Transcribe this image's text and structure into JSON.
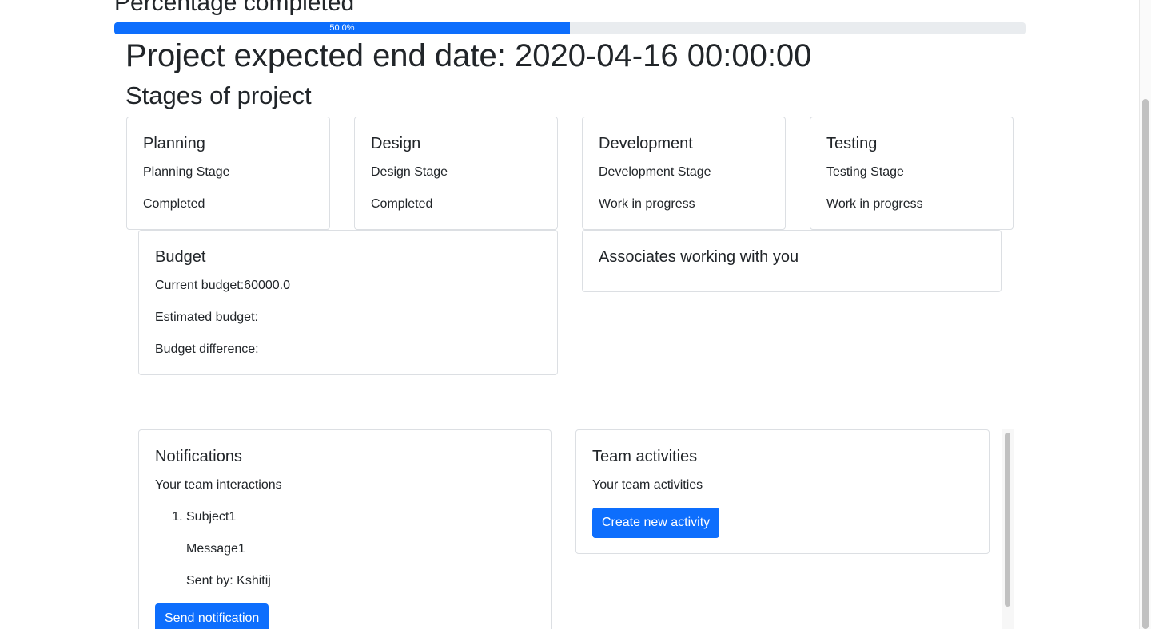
{
  "progress": {
    "title": "Percentage completed",
    "value_percent": 50.0,
    "label": "50.0%"
  },
  "project": {
    "end_date_heading": "Project expected end date: 2020-04-16 00:00:00",
    "stages_heading": "Stages of project"
  },
  "stages": [
    {
      "title": "Planning",
      "description": "Planning Stage",
      "status": "Completed"
    },
    {
      "title": "Design",
      "description": "Design Stage",
      "status": "Completed"
    },
    {
      "title": "Development",
      "description": "Development Stage",
      "status": "Work in progress"
    },
    {
      "title": "Testing",
      "description": "Testing Stage",
      "status": "Work in progress"
    }
  ],
  "budget": {
    "title": "Budget",
    "current": "Current budget:60000.0",
    "estimated": "Estimated budget:",
    "difference": "Budget difference:"
  },
  "associates": {
    "title": "Associates working with you"
  },
  "notifications": {
    "title": "Notifications",
    "subtitle": "Your team interactions",
    "items": [
      {
        "subject": "Subject1",
        "message": "Message1",
        "sent_by": "Sent by: Kshitij"
      }
    ],
    "button_label": "Send notification"
  },
  "team_activities": {
    "title": "Team activities",
    "subtitle": "Your team activities",
    "button_label": "Create new activity"
  },
  "colors": {
    "primary": "#0d6efd",
    "progress_track": "#e9ecef",
    "text": "#212529",
    "card_border": "#dcdfe3"
  }
}
